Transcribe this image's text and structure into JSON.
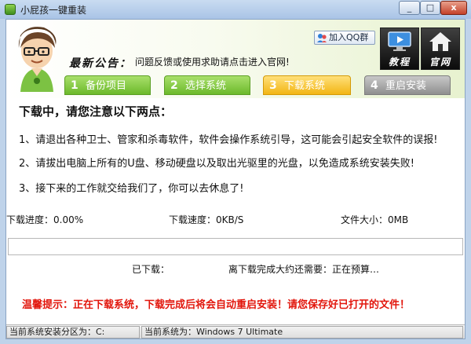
{
  "window": {
    "title": "小屁孩一键重装"
  },
  "header": {
    "notice_label": "最新公告：",
    "notice_text": "问题反馈或使用求助请点击进入官网!",
    "qq_button": "加入QQ群",
    "tutorial_label": "教程",
    "website_label": "官网"
  },
  "steps": [
    {
      "num": "1",
      "label": "备份项目",
      "state": "done"
    },
    {
      "num": "2",
      "label": "选择系统",
      "state": "done"
    },
    {
      "num": "3",
      "label": "下载系统",
      "state": "active"
    },
    {
      "num": "4",
      "label": "重启安装",
      "state": "pending"
    }
  ],
  "body": {
    "heading": "下载中，请您注意以下两点：",
    "items": [
      "1、请退出各种卫士、管家和杀毒软件，软件会操作系统引导，这可能会引起安全软件的误报!",
      "2、请拔出电脑上所有的U盘、移动硬盘以及取出光驱里的光盘，以免造成系统安装失败!",
      "3、接下来的工作就交给我们了，你可以去休息了!"
    ]
  },
  "download": {
    "progress_text": "下载进度：0.00%",
    "speed_text": "下载速度：0KB/S",
    "size_text": "文件大小：0MB",
    "progress_fraction": 0.0,
    "downloaded_label": "已下载：",
    "remaining_text": "离下载完成大约还需要：正在预算…"
  },
  "tip": "温馨提示：正在下载系统，下载完成后将会自动重启安装！请您保存好已打开的文件！",
  "statusbar": {
    "partition": "当前系统安装分区为：C:",
    "system": "当前系统为：Windows 7 Ultimate"
  },
  "colors": {
    "step_done": "#6cb92b",
    "step_active": "#f2b514",
    "step_pending": "#8f8f8f",
    "tip": "#e2160c",
    "progress_fill": "#4cb84c"
  }
}
